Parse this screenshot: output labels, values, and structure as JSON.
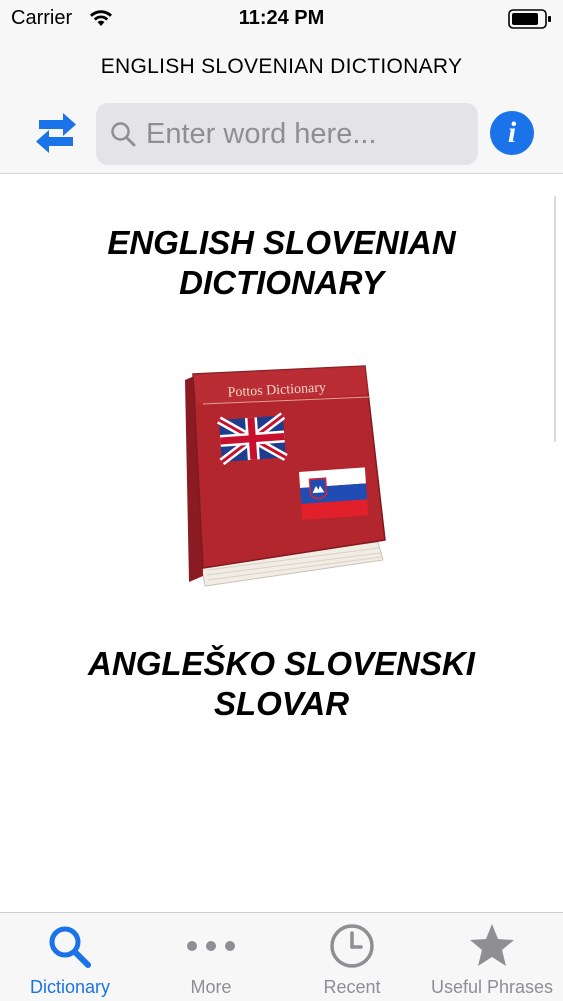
{
  "status_bar": {
    "carrier": "Carrier",
    "time": "11:24 PM"
  },
  "nav": {
    "title": "ENGLISH SLOVENIAN DICTIONARY"
  },
  "search": {
    "placeholder": "Enter word here...",
    "value": ""
  },
  "content": {
    "title_line1": "ENGLISH SLOVENIAN",
    "title_line2": "DICTIONARY",
    "book_label": "Pottos Dictionary",
    "subtitle_line1": "ANGLEŠKO SLOVENSKI",
    "subtitle_line2": "SLOVAR"
  },
  "tabs": [
    {
      "label": "Dictionary",
      "icon": "search-icon",
      "active": true
    },
    {
      "label": "More",
      "icon": "more-dots-icon",
      "active": false
    },
    {
      "label": "Recent",
      "icon": "clock-icon",
      "active": false
    },
    {
      "label": "Useful Phrases",
      "icon": "star-icon",
      "active": false
    }
  ],
  "colors": {
    "accent": "#1a73e8",
    "tab_inactive": "#8e8e93",
    "book_red": "#b3262e"
  }
}
